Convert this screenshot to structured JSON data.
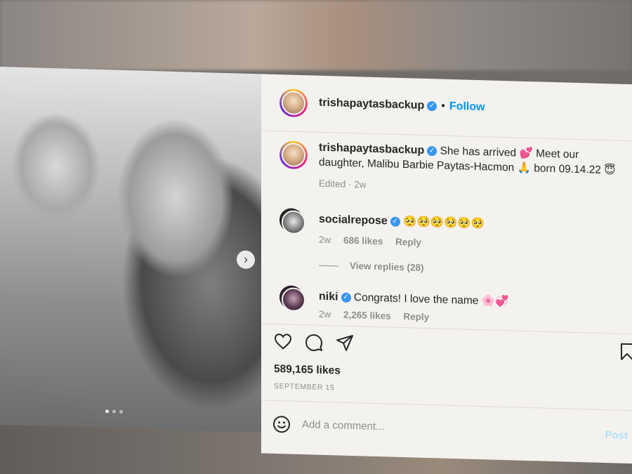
{
  "header": {
    "username": "trishapaytasbackup",
    "separator": "•",
    "follow_label": "Follow"
  },
  "caption": {
    "username": "trishapaytasbackup",
    "text_1": "She has arrived",
    "emoji_1": "💕",
    "text_2": "Meet our daughter, Malibu Barbie Paytas-Hacmon",
    "emoji_2": "🙏",
    "text_3": "born 09.14.22",
    "emoji_3": "😇",
    "meta": "Edited · 2w"
  },
  "comments": [
    {
      "username": "socialrepose",
      "text": "🥺🥺🥺🥺🥺🥺",
      "age": "2w",
      "likes": "686 likes",
      "reply": "Reply",
      "view_replies": "View replies (28)"
    },
    {
      "username": "niki",
      "text": "Congrats! I love the name",
      "emoji": "🌸💞",
      "age": "2w",
      "likes": "2,265 likes",
      "reply": "Reply"
    }
  ],
  "post": {
    "likes": "589,165 likes",
    "date": "SEPTEMBER 15"
  },
  "comment_box": {
    "placeholder": "Add a comment...",
    "post_label": "Post"
  },
  "icons": {
    "like": "heart-icon",
    "comment": "comment-bubble-icon",
    "share": "paper-plane-icon",
    "save": "bookmark-icon",
    "emoji": "smiley-icon",
    "next": "chevron-right-icon"
  },
  "colors": {
    "follow": "#0095f6",
    "verified": "#3897f0",
    "post_disabled": "#b2dffc"
  }
}
